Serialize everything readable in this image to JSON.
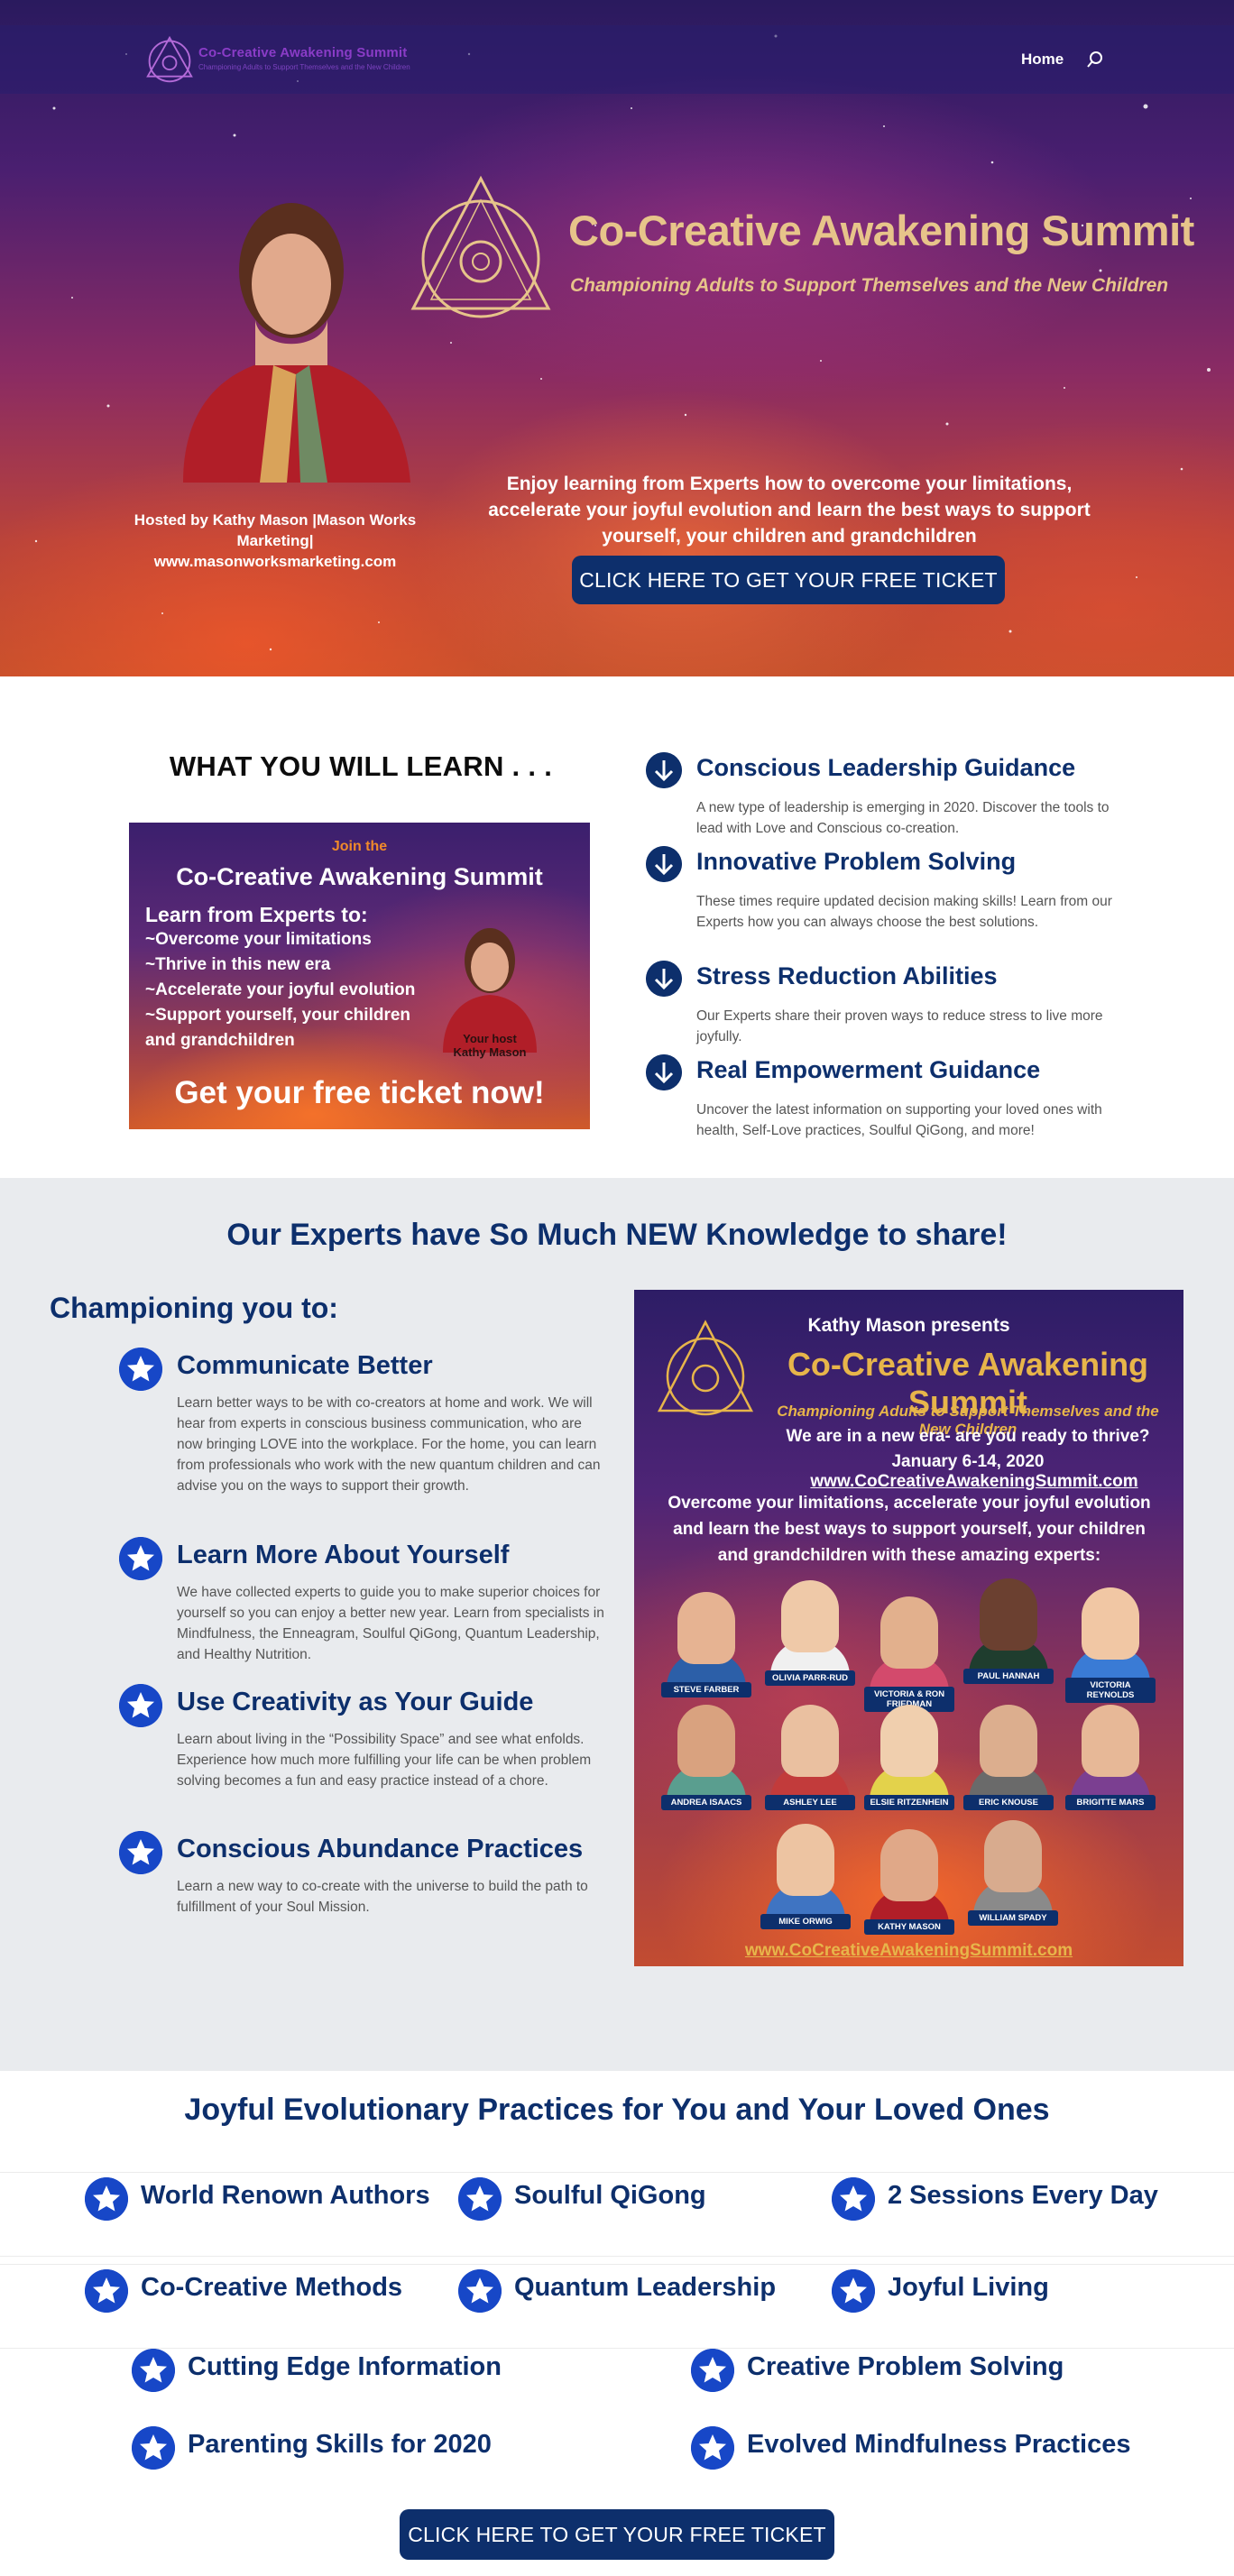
{
  "nav": {
    "brand_title": "Co-Creative Awakening Summit",
    "brand_tagline": "Championing Adults to Support Themselves and the New Children",
    "home_label": "Home",
    "search_icon": "search-icon"
  },
  "hero": {
    "title": "Co-Creative Awakening Summit",
    "subtitle": "Championing Adults to Support Themselves and the New Children",
    "host_line1": "Hosted by Kathy Mason |Mason Works",
    "host_line2": "Marketing|",
    "host_line3": "www.masonworksmarketing.com",
    "intro": "Enjoy learning from Experts how to overcome your limitations, accelerate your joyful evolution and learn the best ways to support yourself, your children and grandchildren",
    "cta": "CLICK HERE TO GET YOUR FREE TICKET"
  },
  "learn": {
    "heading": "WHAT YOU WILL LEARN . . .",
    "promo": {
      "join": "Join the",
      "title": "Co-Creative Awakening Summit",
      "lines": [
        "Learn from Experts to:",
        "~Overcome your limitations",
        "~Thrive in this new era",
        "~Accelerate your joyful evolution",
        "~Support yourself, your children",
        "and grandchildren"
      ],
      "host1": "Your host",
      "host2": "Kathy Mason",
      "cta": "Get your free ticket now!"
    },
    "features": [
      {
        "title": "Conscious Leadership Guidance",
        "desc": "A new type of leadership is emerging in 2020. Discover the tools to lead with Love and Conscious co-creation."
      },
      {
        "title": "Innovative Problem Solving",
        "desc": "These times require updated decision making skills! Learn from our Experts how you can always choose the best solutions."
      },
      {
        "title": "Stress Reduction Abilities",
        "desc": "Our Experts share their proven ways to reduce stress to live more joyfully."
      },
      {
        "title": "Real Empowerment Guidance",
        "desc": "Uncover the latest information on supporting your loved ones with health, Self-Love practices, Soulful QiGong, and more!"
      }
    ]
  },
  "experts": {
    "heading": "Our Experts have So Much NEW Knowledge to share!",
    "champion_heading": "Championing you to:",
    "items": [
      {
        "title": "Communicate Better",
        "desc": "Learn better ways to be with co-creators at home and work. We will hear from experts in conscious business communication, who are now bringing LOVE into the workplace. For the home, you can learn from professionals who work with the new quantum children and can advise you on the ways to support their growth."
      },
      {
        "title": "Learn More About Yourself",
        "desc": "We have collected experts to guide you to make superior choices for yourself  so you can enjoy a better new year.  Learn from specialists in Mindfulness, the Enneagram, Soulful QiGong, Quantum Leadership, and Healthy Nutrition."
      },
      {
        "title": "Use Creativity as Your Guide",
        "desc": "Learn about living in the “Possibility Space” and see what enfolds. Experience how much more fulfilling your life can be when problem solving becomes a fun and easy practice instead of a chore."
      },
      {
        "title": "Conscious Abundance Practices",
        "desc": "Learn a new way to co-create with the universe to build the path to fulfillment of your Soul Mission."
      }
    ],
    "poster": {
      "presents": "Kathy Mason presents",
      "title": "Co-Creative Awakening Summit",
      "tagline": "Championing Adults to Support Themselves and the New Children",
      "question": "We are in a new era- are you ready to thrive?",
      "dates": "January 6-14, 2020",
      "site": "www.CoCreativeAwakeningSummit.com",
      "blurb": "Overcome your limitations, accelerate your joyful evolution and learn the best ways to support yourself, your children and grandchildren with these amazing experts:",
      "names": [
        "STEVE FARBER",
        "OLIVIA PARR-RUD",
        "VICTORIA & RON FRIEDMAN",
        "PAUL HANNAH",
        "VICTORIA REYNOLDS",
        "ANDREA ISAACS",
        "ASHLEY LEE",
        "ELSIE RITZENHEIN",
        "ERIC KNOUSE",
        "BRIGITTE MARS",
        "MIKE ORWIG",
        "KATHY MASON",
        "WILLIAM SPADY"
      ],
      "url": "www.CoCreativeAwakeningSummit.com"
    }
  },
  "joyful": {
    "heading": "Joyful Evolutionary Practices for You and Your Loved Ones",
    "items": [
      "World Renown Authors",
      "Soulful QiGong",
      "2 Sessions Every Day",
      "Co-Creative Methods",
      "Quantum Leadership",
      "Joyful Living",
      "Cutting Edge Information",
      "Creative Problem Solving",
      "Parenting Skills for 2020",
      "Evolved Mindfulness Practices"
    ],
    "cta": "CLICK HERE TO GET YOUR FREE TICKET"
  },
  "colors": {
    "navy": "#0d2f6c",
    "star_blue": "#1747c7",
    "gold": "#e7c48a",
    "gray_bg": "#e9ebee"
  }
}
